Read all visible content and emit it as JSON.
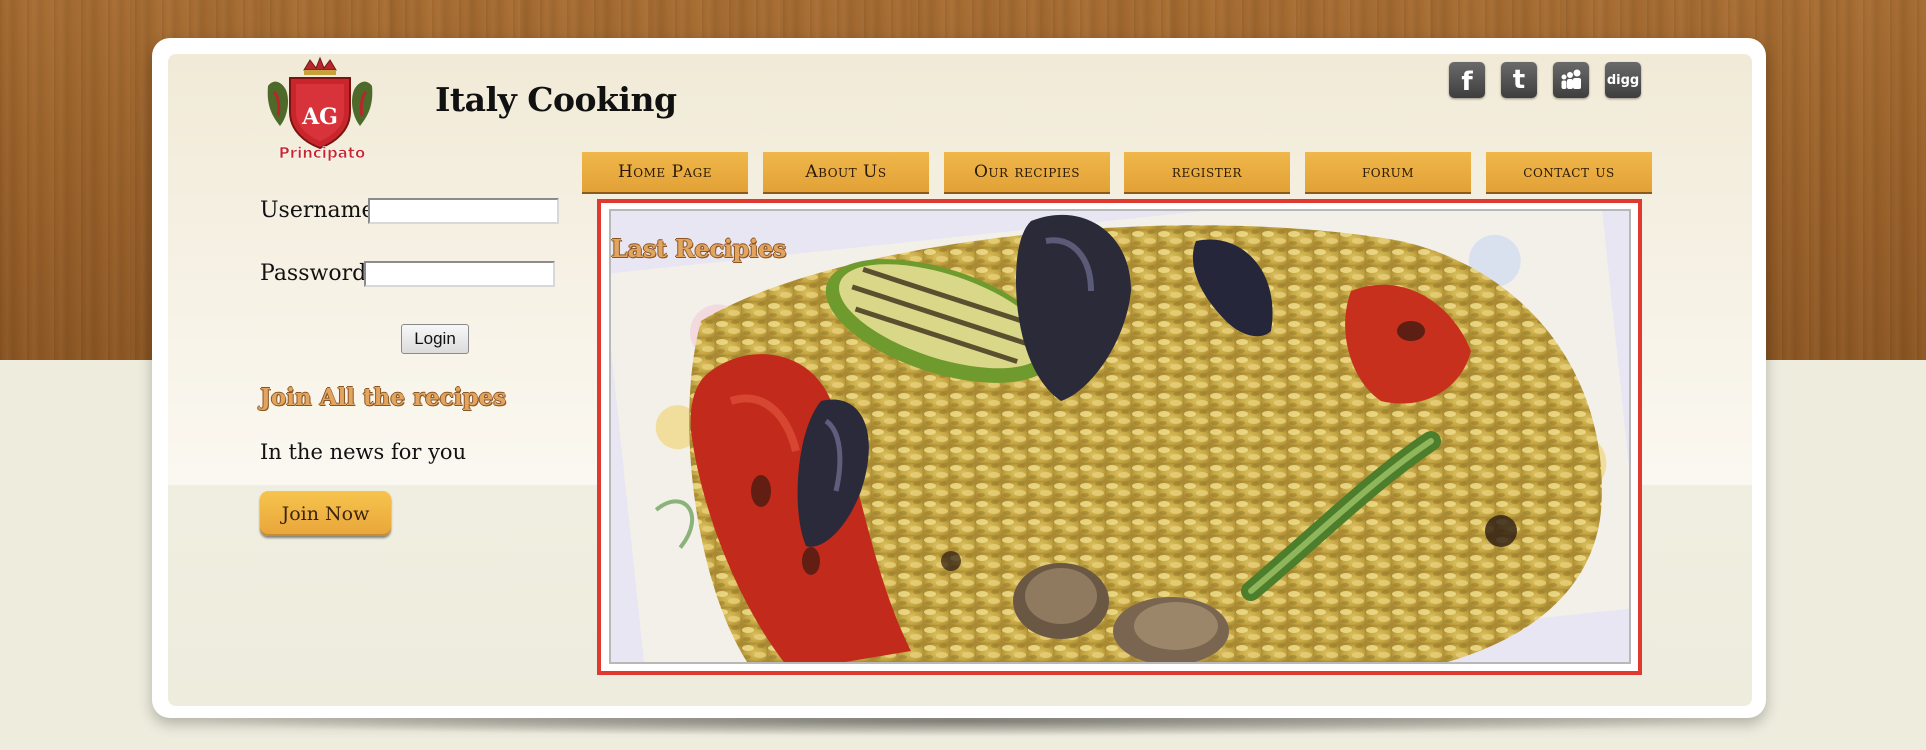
{
  "site": {
    "title": "Italy Cooking",
    "logo_text": "Principato",
    "logo_monogram": "AG"
  },
  "social": [
    {
      "name": "facebook",
      "glyph": "f"
    },
    {
      "name": "twitter",
      "glyph": "t"
    },
    {
      "name": "myspace",
      "glyph": "myspace-icon"
    },
    {
      "name": "digg",
      "glyph": "digg"
    }
  ],
  "nav": {
    "items": [
      {
        "label": "Home Page"
      },
      {
        "label": "About Us"
      },
      {
        "label": "Our recipies"
      },
      {
        "label": "register"
      },
      {
        "label": "forum"
      },
      {
        "label": "contact us"
      }
    ]
  },
  "login": {
    "username_label": "Username:",
    "username_value": "",
    "password_label": "Password:",
    "password_value": "",
    "button_label": "Login"
  },
  "sidebar": {
    "join_heading": "Join All the recipes",
    "news_text": "In the news for you",
    "join_button": "Join Now"
  },
  "feature": {
    "heading": "Last Recipies"
  },
  "colors": {
    "accent": "#e8a53a",
    "highlight_border": "#e0392f",
    "heading_orange": "#e2a55f"
  }
}
